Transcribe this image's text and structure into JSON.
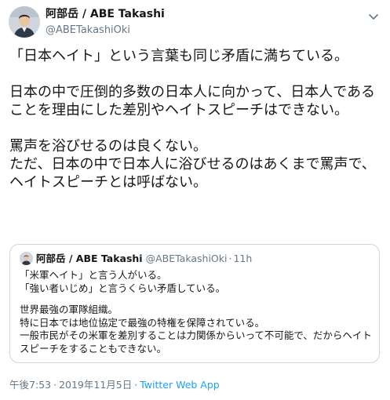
{
  "author": {
    "display_name": "阿部岳 / ABE Takashi",
    "handle": "@ABETakashiOki"
  },
  "tweet": {
    "paragraphs": [
      "「日本ヘイト」という言葉も同じ矛盾に満ちている。",
      "日本の中で圧倒的多数の日本人に向かって、日本人であることを理由にした差別やヘイトスピーチはできない。",
      "罵声を浴びせるのは良くない。\nただ、日本の中で日本人に浴びせるのはあくまで罵声で、ヘイトスピーチとは呼ばない。"
    ]
  },
  "quoted_tweet": {
    "display_name": "阿部岳 / ABE Takashi",
    "handle": "@ABETakashiOki",
    "separator": "·",
    "time": "11h",
    "paragraphs": [
      "「米軍ヘイト」と言う人がいる。\n「強い者いじめ」と言うくらい矛盾している。",
      "世界最強の軍隊組織。\n特に日本では地位協定で最強の特権を保障されている。\n一般市民がその米軍を差別することは力関係からいって不可能で、だからヘイトスピーチをすることもできない。"
    ]
  },
  "meta": {
    "time": "午後7:53",
    "separator": "·",
    "date": "2019年11月5日",
    "source": "Twitter Web App"
  },
  "icons": {
    "more": "chevron-down-icon"
  },
  "colors": {
    "text": "#14171a",
    "secondary": "#657786",
    "link": "#1da1f2",
    "border": "#ccd6dd"
  }
}
